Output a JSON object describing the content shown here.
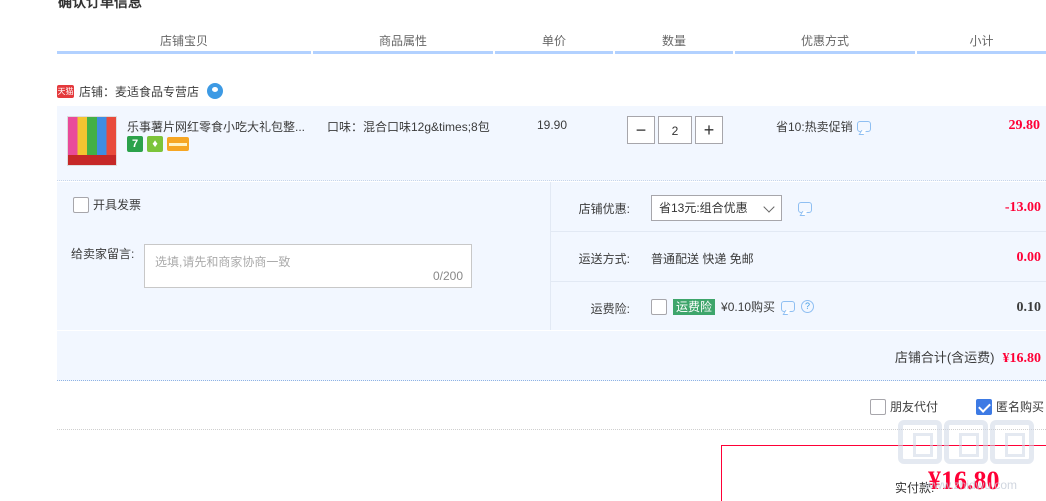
{
  "section_title": "确认订单信息",
  "columns": [
    "店铺宝贝",
    "商品属性",
    "单价",
    "数量",
    "优惠方式",
    "小计"
  ],
  "shop": {
    "badge": "天猫",
    "name": "店铺：麦适食品专营店"
  },
  "item": {
    "title": "乐事薯片网红零食小吃大礼包整...",
    "icon_seven": "7",
    "property": "口味：混合口味12g&times;8包",
    "unit_price": "19.90",
    "quantity": "2",
    "promotion": "省10:热卖促销",
    "subtotal": "29.80"
  },
  "invoice_label": "开具发票",
  "message": {
    "label": "给卖家留言:",
    "placeholder": "选填,请先和商家协商一致",
    "counter": "0/200"
  },
  "shop_discount": {
    "label": "店铺优惠:",
    "selected": "省13元:组合优惠",
    "amount": "-13.00"
  },
  "shipping": {
    "label": "运送方式:",
    "text": "普通配送 快递 免邮",
    "amount": "0.00"
  },
  "insurance": {
    "label": "运费险:",
    "tag": "运费险",
    "price_text": "¥0.10购买",
    "amount": "0.10"
  },
  "shop_total": {
    "label": "店铺合计(含运费)",
    "value": "¥16.80"
  },
  "pay_options": {
    "friend_pay": "朋友代付",
    "anonymous": "匿名购买"
  },
  "final": {
    "label": "实付款:",
    "amount": "¥16.80"
  },
  "watermark_text": "www.zhidwu.com",
  "colors": {
    "price_red": "#ff0036",
    "panel_bg": "#f2f7ff",
    "header_line": "#b2d1ff",
    "accent_blue": "#3d7ae4"
  }
}
